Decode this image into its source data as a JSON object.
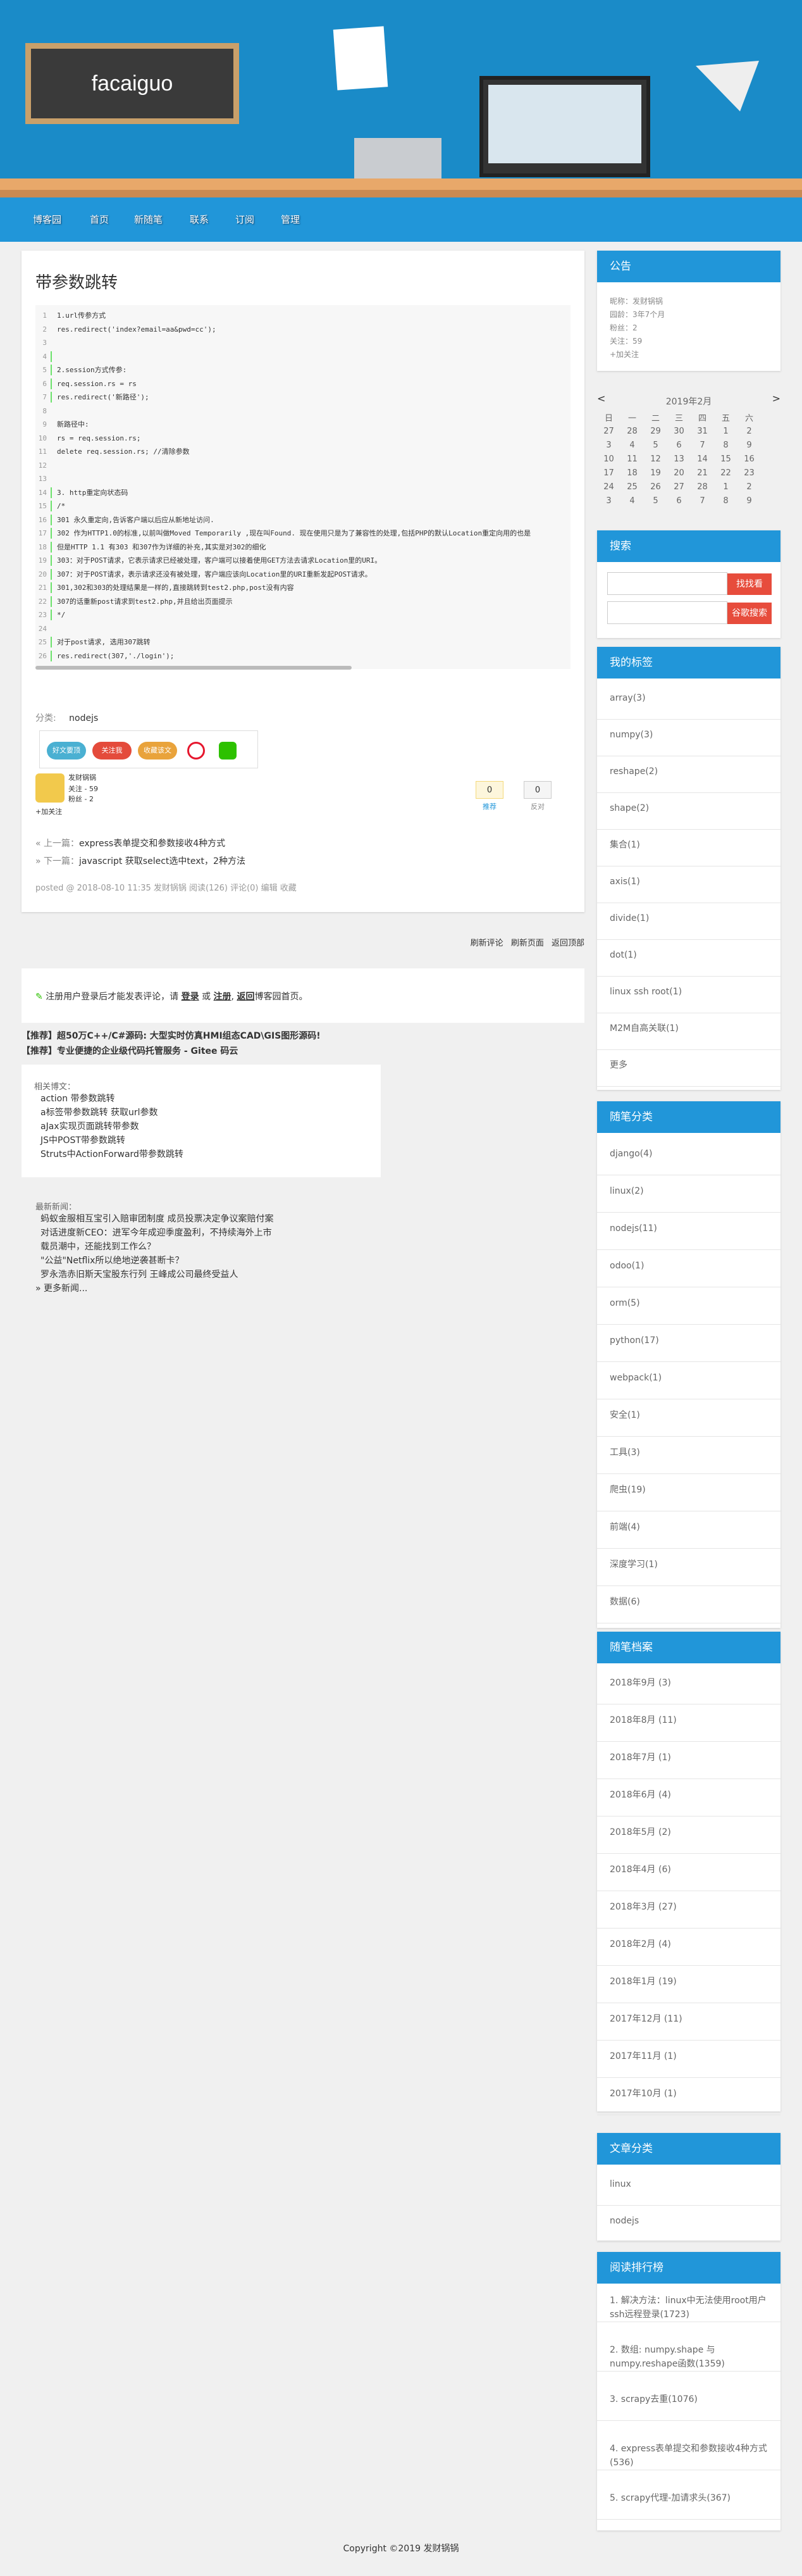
{
  "header": {
    "logo": "facaiguo"
  },
  "nav": [
    "博客园",
    "首页",
    "新随笔",
    "联系",
    "订阅",
    "管理"
  ],
  "post": {
    "title": "带参数跳转",
    "code": [
      [
        "1",
        "1.url传参方式",
        0
      ],
      [
        "2",
        "res.redirect('index?email=aa&pwd=cc');",
        0
      ],
      [
        "3",
        "",
        0
      ],
      [
        "4",
        "",
        1
      ],
      [
        "5",
        "2.session方式传参:",
        1
      ],
      [
        "6",
        "req.session.rs = rs",
        1
      ],
      [
        "7",
        "res.redirect('新路径');",
        1
      ],
      [
        "8",
        "",
        0
      ],
      [
        "9",
        "新路径中:",
        0
      ],
      [
        "10",
        "rs = req.session.rs;",
        0
      ],
      [
        "11",
        "delete req.session.rs; //清除参数",
        0
      ],
      [
        "12",
        "",
        0
      ],
      [
        "13",
        "",
        0
      ],
      [
        "14",
        "3. http重定向状态码",
        1
      ],
      [
        "15",
        "/*",
        1
      ],
      [
        "16",
        "301 永久重定向,告诉客户端以后应从新地址访问.",
        1
      ],
      [
        "17",
        "302 作为HTTP1.0的标准,以前叫做Moved Temporarily ,现在叫Found. 现在使用只是为了兼容性的处理,包括PHP的默认Location重定向用的也是",
        1
      ],
      [
        "18",
        "但是HTTP 1.1 有303 和307作为详细的补充,其实是对302的细化",
        1
      ],
      [
        "19",
        "303：对于POST请求，它表示请求已经被处理，客户端可以接着使用GET方法去请求Location里的URI。",
        1
      ],
      [
        "20",
        "307：对于POST请求，表示请求还没有被处理，客户端应该向Location里的URI重新发起POST请求。",
        1
      ],
      [
        "21",
        "301,302和303的处理结果是一样的,直接跳转到test2.php,post没有内容",
        1
      ],
      [
        "22",
        "307的话重新post请求到test2.php,并且给出页面提示",
        1
      ],
      [
        "23",
        "*/",
        1
      ],
      [
        "24",
        "",
        0
      ],
      [
        "25",
        "对于post请求, 选用307跳转",
        1
      ],
      [
        "26",
        "res.redirect(307,'./login');",
        1
      ]
    ],
    "category_label": "分类:",
    "category": "nodejs",
    "share_buttons": [
      "好文要顶",
      "关注我",
      "收藏该文"
    ],
    "author": {
      "name": "发财锅锅",
      "follow": "关注 - 59",
      "fans": "粉丝 - 2",
      "add": "+加关注"
    },
    "votes": {
      "digg": "0",
      "digg_label": "推荐",
      "bury": "0",
      "bury_label": "反对"
    },
    "prev": "« 上一篇：",
    "prev_title": "express表单提交和参数接收4种方式",
    "next": "» 下一篇：",
    "next_title": "javascript 获取select选中text，2种方法",
    "footer": "posted @ 2018-08-10 11:35 发财锅锅 阅读(126) 评论(0) 编辑 收藏"
  },
  "comments": {
    "links": [
      "刷新评论",
      "刷新页面",
      "返回顶部"
    ],
    "login_note": "注册用户登录后才能发表评论，请",
    "login": "登录",
    "or": "或",
    "register": "注册",
    "back": "返回",
    "home": "博客园首页。",
    "ad1": "【推荐】超50万C++/C#源码: 大型实时仿真HMI组态CAD\\GIS图形源码!",
    "ad2": "【推荐】专业便捷的企业级代码托管服务 - Gitee 码云",
    "related_title": "相关博文：",
    "related": [
      "action 带参数跳转",
      "a标签带参数跳转 获取url参数",
      "aJax实现页面跳转带参数",
      "JS中POST带参数跳转",
      "Struts中ActionForward带参数跳转"
    ],
    "news_title": "最新新闻：",
    "news": [
      "蚂蚁金服相互宝引入赔审团制度 成员投票决定争议案赔付案",
      "对话进度新CEO：进军今年成迎季度盈利，不持续海外上市",
      "载员潮中，还能找到工作么？",
      "\"公益\"Netflix所以绝地逆袭甚断卡？",
      "罗永浩赤旧斯天宝股东行列 王峰成公司最终受益人"
    ],
    "more": "» 更多新闻..."
  },
  "notice": {
    "title": "公告",
    "lines": [
      "昵称：发财锅锅",
      "园龄：3年7个月",
      "粉丝：2",
      "关注：59",
      "+加关注"
    ]
  },
  "calendar": {
    "prev": "<",
    "month": "2019年2月",
    "next": ">",
    "weekdays": [
      "日",
      "一",
      "二",
      "三",
      "四",
      "五",
      "六"
    ],
    "weeks": [
      [
        "27",
        "28",
        "29",
        "30",
        "31",
        "1",
        "2"
      ],
      [
        "3",
        "4",
        "5",
        "6",
        "7",
        "8",
        "9"
      ],
      [
        "10",
        "11",
        "12",
        "13",
        "14",
        "15",
        "16"
      ],
      [
        "17",
        "18",
        "19",
        "20",
        "21",
        "22",
        "23"
      ],
      [
        "24",
        "25",
        "26",
        "27",
        "28",
        "1",
        "2"
      ],
      [
        "3",
        "4",
        "5",
        "6",
        "7",
        "8",
        "9"
      ]
    ]
  },
  "search": {
    "title": "搜索",
    "btn1": "找找看",
    "btn2": "谷歌搜索"
  },
  "tags": {
    "title": "我的标签",
    "items": [
      "array(3)",
      "numpy(3)",
      "reshape(2)",
      "shape(2)",
      "集合(1)",
      "axis(1)",
      "divide(1)",
      "dot(1)",
      "linux ssh root(1)",
      "M2M自高关联(1)",
      "更多"
    ]
  },
  "categories": {
    "title": "随笔分类",
    "items": [
      "django(4)",
      "linux(2)",
      "nodejs(11)",
      "odoo(1)",
      "orm(5)",
      "python(17)",
      "webpack(1)",
      "安全(1)",
      "工具(3)",
      "爬虫(19)",
      "前端(4)",
      "深度学习(1)",
      "数据(6)"
    ]
  },
  "archives": {
    "title": "随笔档案",
    "items": [
      "2018年9月 (3)",
      "2018年8月 (11)",
      "2018年7月 (1)",
      "2018年6月 (4)",
      "2018年5月 (2)",
      "2018年4月 (6)",
      "2018年3月 (27)",
      "2018年2月 (4)",
      "2018年1月 (19)",
      "2017年12月 (11)",
      "2017年11月 (1)",
      "2017年10月 (1)"
    ]
  },
  "article_cat": {
    "title": "文章分类",
    "items": [
      "linux",
      "nodejs"
    ]
  },
  "ranking": {
    "title": "阅读排行榜",
    "items": [
      "1. 解决方法：linux中无法使用root用户ssh远程登录(1723)",
      "2. 数组: numpy.shape 与numpy.reshape函数(1359)",
      "3. scrapy去重(1076)",
      "4. express表单提交和参数接收4种方式(536)",
      "5. scrapy代理-加请求头(367)"
    ]
  },
  "copyright": "Copyright ©2019 发财锅锅"
}
